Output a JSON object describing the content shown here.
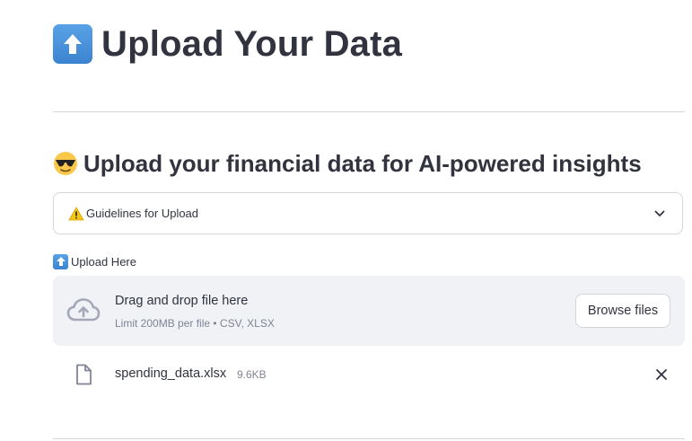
{
  "header": {
    "icon": "up-arrow-emoji-icon",
    "title": "Upload Your Data"
  },
  "section": {
    "icon": "sunglasses-emoji-icon",
    "title": "Upload your financial data for AI-powered insights"
  },
  "expander": {
    "icon": "warning-emoji-icon",
    "label": "Guidelines for Upload",
    "state": "collapsed"
  },
  "uploader": {
    "label_icon": "up-arrow-emoji-icon",
    "label": "Upload Here",
    "drop_text": "Drag and drop file here",
    "limit_text": "Limit 200MB per file • CSV, XLSX",
    "browse_label": "Browse files"
  },
  "uploaded_file": {
    "name": "spending_data.xlsx",
    "size": "9.6KB"
  },
  "colors": {
    "text": "#31333f",
    "muted": "#808495",
    "dropzone_bg": "#f0f2f6",
    "border": "#d6d6d9"
  }
}
